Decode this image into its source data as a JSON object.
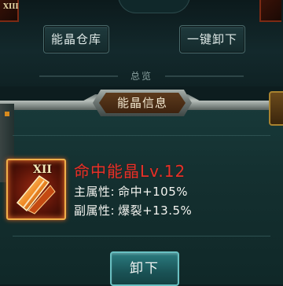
{
  "top": {
    "corner_left_roman": "XIII",
    "storage_button": "能晶仓库",
    "unequip_all_button": "一键卸下",
    "overview_label": "总览"
  },
  "panel": {
    "title": "能晶信息",
    "gem": {
      "roman": "XII",
      "name": "命中能晶Lv.12",
      "main_attr_label": "主属性:",
      "main_attr_value": "命中+105%",
      "sub_attr_label": "副属性:",
      "sub_attr_value": "爆裂+13.5%"
    },
    "unequip_button": "卸下"
  },
  "colors": {
    "gem_name": "#e5322a",
    "attr_text": "#f4f4f0",
    "button_teal": "#2b7c80",
    "gem_frame": "#f0b04a"
  }
}
